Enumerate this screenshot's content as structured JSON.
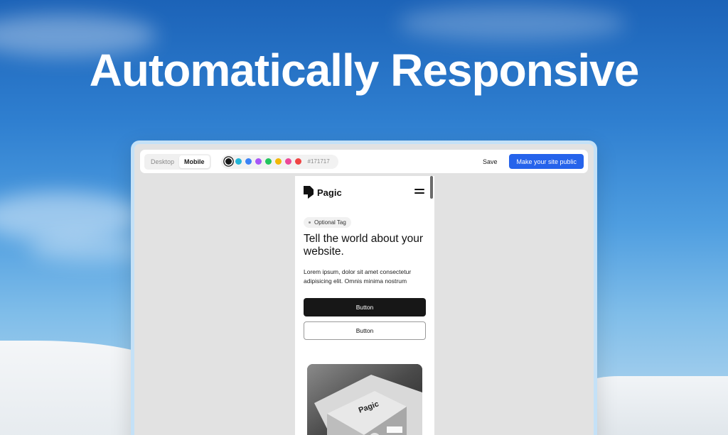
{
  "hero": {
    "title": "Automatically Responsive"
  },
  "toolbar": {
    "view_modes": [
      {
        "label": "Desktop",
        "active": false
      },
      {
        "label": "Mobile",
        "active": true
      }
    ],
    "palette": {
      "colors": [
        "#171717",
        "#22b5d8",
        "#3b82f6",
        "#a855f7",
        "#22c55e",
        "#f2b705",
        "#ec4899",
        "#ef4444"
      ],
      "selected_hex": "#171717"
    },
    "save_label": "Save",
    "publish_label": "Make your site public",
    "accent_color": "#2563eb"
  },
  "mobile_preview": {
    "brand": "Pagic",
    "tag": "Optional Tag",
    "headline": "Tell the world about your website.",
    "body": "Lorem ipsum, dolor sit amet consectetur adipisicing elit. Omnis minima nostrum",
    "primary_button": "Button",
    "secondary_button": "Button",
    "image_brand": "Pagic"
  }
}
